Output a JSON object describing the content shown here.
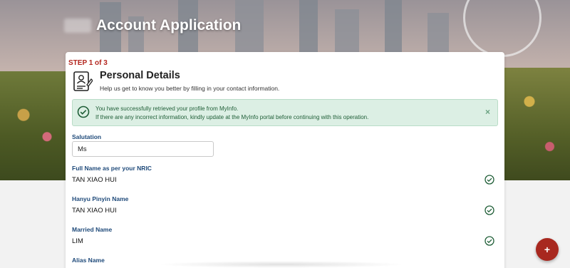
{
  "header": {
    "title": "Account Application"
  },
  "form": {
    "step": "STEP 1 of 3",
    "section_title": "Personal Details",
    "section_subtitle": "Help us get to know you better by filling in your contact information.",
    "alert": {
      "line1": "You have successfully retrieved your profile from MyInfo.",
      "line2": "If there are any incorrect information, kindly update at the MyInfo portal before continuing with this operation.",
      "close": "×"
    },
    "salutation": {
      "label": "Salutation",
      "value": "Ms"
    },
    "full_name": {
      "label": "Full Name as per your NRIC",
      "value": "TAN XIAO HUI"
    },
    "hanyu_name": {
      "label": "Hanyu Pinyin Name",
      "value": "TAN XIAO HUI"
    },
    "married_name": {
      "label": "Married Name",
      "value": "LIM"
    },
    "alias_name": {
      "label": "Alias Name"
    }
  },
  "fab": {
    "label": "+"
  },
  "colors": {
    "accent": "#b3261e",
    "label_blue": "#1f4a7a",
    "success_green": "#1f5e37"
  },
  "icons": [
    "document-person-icon",
    "check-circle-icon",
    "close-icon",
    "plus-icon"
  ]
}
